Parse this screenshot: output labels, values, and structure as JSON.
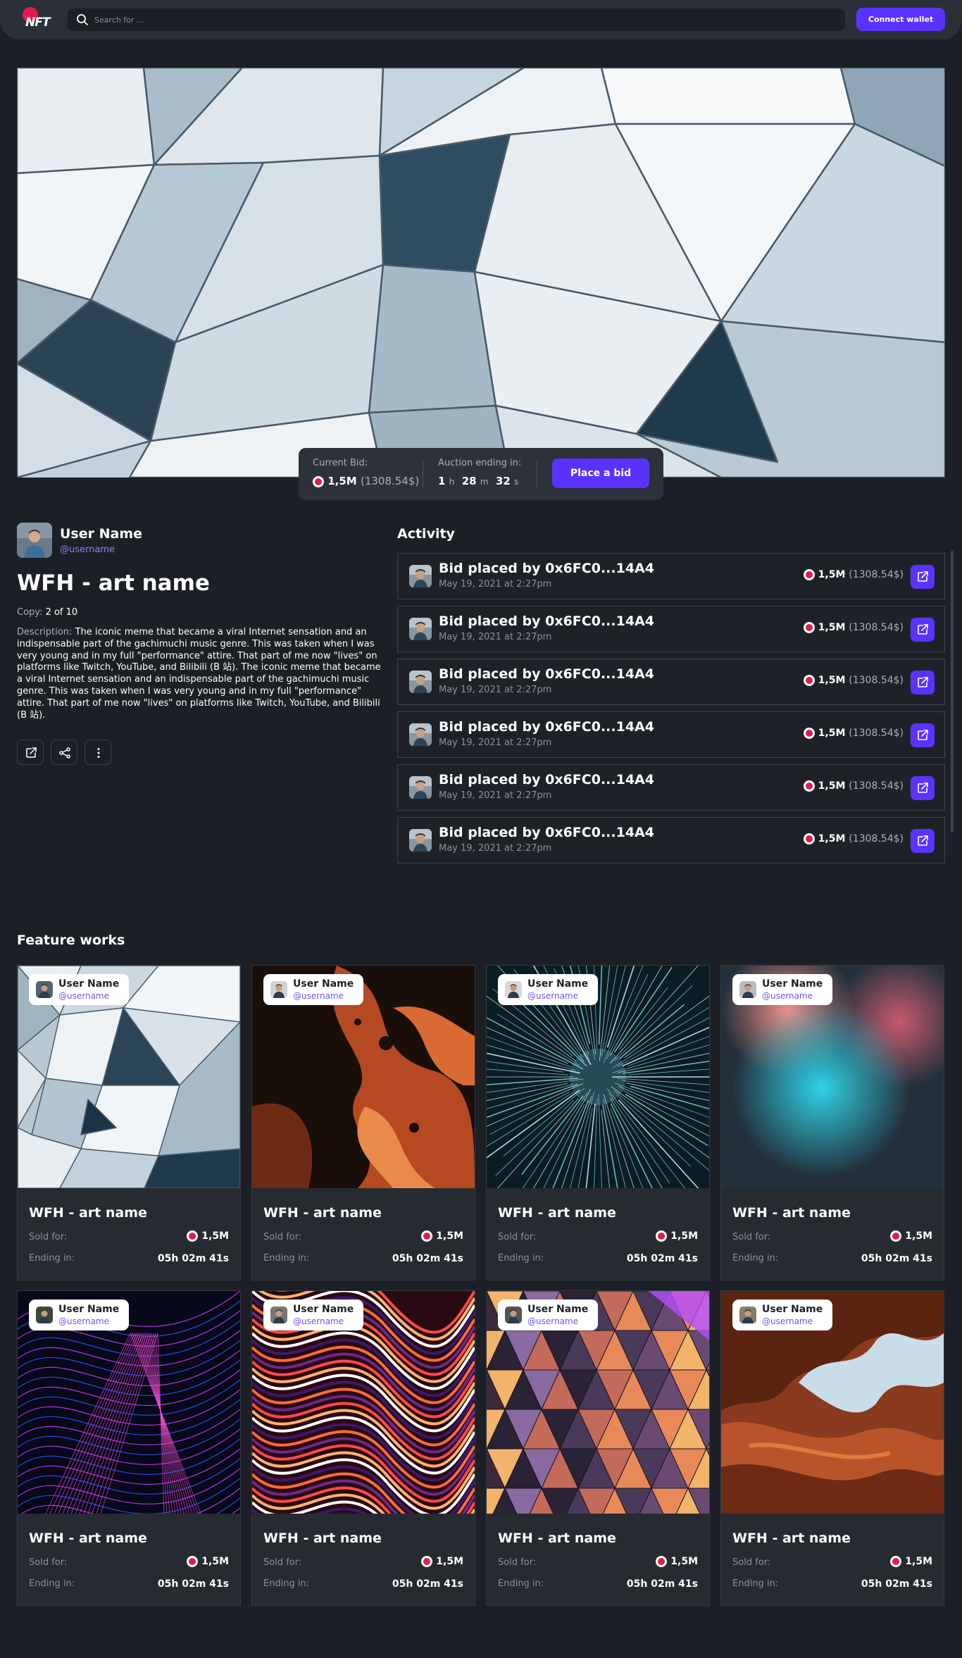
{
  "header": {
    "logo_text": "NFT",
    "search_placeholder": "Search for ...",
    "connect_label": "Connect wallet"
  },
  "hero": {
    "current_bid_label": "Current Bid:",
    "current_bid_value": "1,5M",
    "current_bid_usd": "(1308.54$)",
    "auction_label": "Auction ending in:",
    "countdown": {
      "h": "1",
      "h_unit": "h",
      "m": "28",
      "m_unit": "m",
      "s": "32",
      "s_unit": "s"
    },
    "place_bid_label": "Place a bid"
  },
  "detail": {
    "user_name": "User Name",
    "user_handle": "@username",
    "title": "WFH - art name",
    "copy_label": "Copy:",
    "copy_value": "2 of 10",
    "description_label": "Description:",
    "description": "The iconic meme that became a viral Internet sensation and an indispensable part of the gachimuchi music genre. This was taken when I was very young and in my full \"performance\" attire. That part of me now \"lives\" on platforms like Twitch, YouTube, and Bilibili (B 站). The iconic meme that became a viral Internet sensation and an indispensable part of the gachimuchi music genre. This was taken when I was very young and in my full \"performance\" attire. That part of me now \"lives\" on platforms like Twitch, YouTube, and Bilibili (B 站)."
  },
  "activity": {
    "title": "Activity",
    "items": [
      {
        "title": "Bid placed by 0x6FC0...14A4",
        "date": "May 19, 2021 at 2:27pm",
        "price": "1,5M",
        "usd": "(1308.54$)"
      },
      {
        "title": "Bid placed by 0x6FC0...14A4",
        "date": "May 19, 2021 at 2:27pm",
        "price": "1,5M",
        "usd": "(1308.54$)"
      },
      {
        "title": "Bid placed by 0x6FC0...14A4",
        "date": "May 19, 2021 at 2:27pm",
        "price": "1,5M",
        "usd": "(1308.54$)"
      },
      {
        "title": "Bid placed by 0x6FC0...14A4",
        "date": "May 19, 2021 at 2:27pm",
        "price": "1,5M",
        "usd": "(1308.54$)"
      },
      {
        "title": "Bid placed by 0x6FC0...14A4",
        "date": "May 19, 2021 at 2:27pm",
        "price": "1,5M",
        "usd": "(1308.54$)"
      },
      {
        "title": "Bid placed by 0x6FC0...14A4",
        "date": "May 19, 2021 at 2:27pm",
        "price": "1,5M",
        "usd": "(1308.54$)"
      }
    ]
  },
  "feature": {
    "title": "Feature works",
    "cards": [
      {
        "user": "User Name",
        "handle": "@username",
        "name": "WFH - art name",
        "sold_label": "Sold for:",
        "sold": "1,5M",
        "ending_label": "Ending in:",
        "ending": "05h 02m 41s",
        "art": "geo-gray"
      },
      {
        "user": "User Name",
        "handle": "@username",
        "name": "WFH - art name",
        "sold_label": "Sold for:",
        "sold": "1,5M",
        "ending_label": "Ending in:",
        "ending": "05h 02m 41s",
        "art": "fluid-orange"
      },
      {
        "user": "User Name",
        "handle": "@username",
        "name": "WFH - art name",
        "sold_label": "Sold for:",
        "sold": "1,5M",
        "ending_label": "Ending in:",
        "ending": "05h 02m 41s",
        "art": "starburst-teal"
      },
      {
        "user": "User Name",
        "handle": "@username",
        "name": "WFH - art name",
        "sold_label": "Sold for:",
        "sold": "1,5M",
        "ending_label": "Ending in:",
        "ending": "05h 02m 41s",
        "art": "blur-teal"
      },
      {
        "user": "User Name",
        "handle": "@username",
        "name": "WFH - art name",
        "sold_label": "Sold for:",
        "sold": "1,5M",
        "ending_label": "Ending in:",
        "ending": "05h 02m 41s",
        "art": "waves-neon"
      },
      {
        "user": "User Name",
        "handle": "@username",
        "name": "WFH - art name",
        "sold_label": "Sold for:",
        "sold": "1,5M",
        "ending_label": "Ending in:",
        "ending": "05h 02m 41s",
        "art": "swirl-red"
      },
      {
        "user": "User Name",
        "handle": "@username",
        "name": "WFH - art name",
        "sold_label": "Sold for:",
        "sold": "1,5M",
        "ending_label": "Ending in:",
        "ending": "05h 02m 41s",
        "art": "geo-sunset"
      },
      {
        "user": "User Name",
        "handle": "@username",
        "name": "WFH - art name",
        "sold_label": "Sold for:",
        "sold": "1,5M",
        "ending_label": "Ending in:",
        "ending": "05h 02m 41s",
        "art": "canyon"
      }
    ]
  },
  "colors": {
    "accent": "#5b33ff",
    "background": "#1c2026",
    "coin": "#e21b4d",
    "handle": "#8f7cff"
  },
  "icons": [
    "search-icon",
    "external-link-icon",
    "share-icon",
    "more-vertical-icon",
    "coin-icon"
  ]
}
